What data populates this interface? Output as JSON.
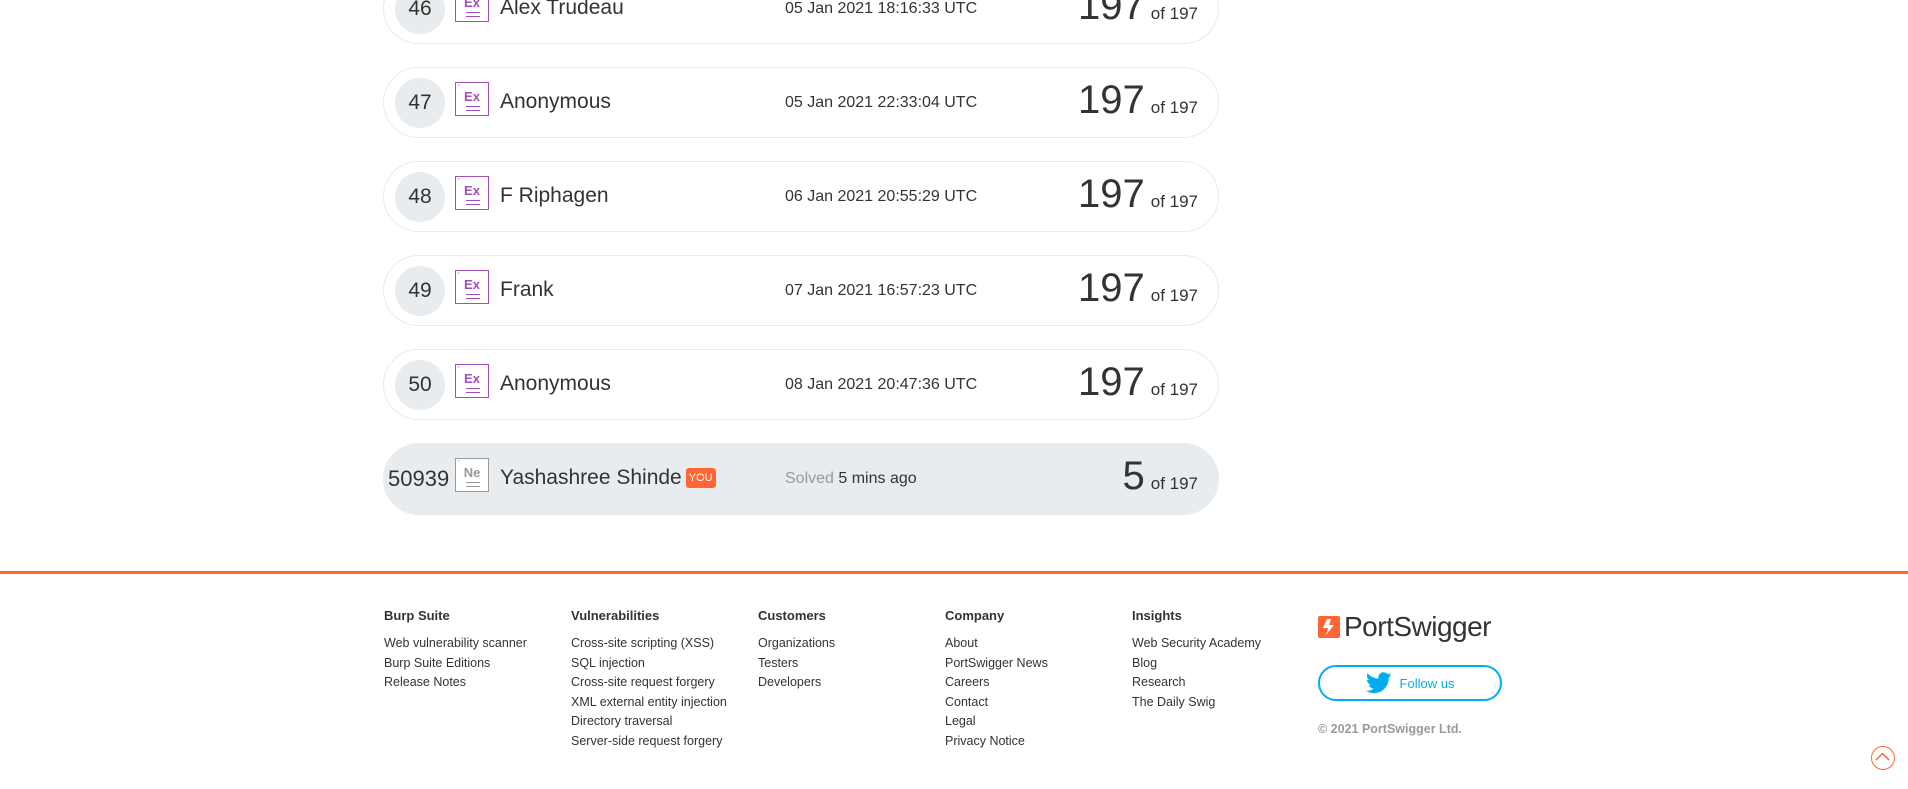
{
  "leaderboard": {
    "total": "of 197",
    "rows": [
      {
        "rank": "46",
        "badge": "Ex",
        "name": "Alex Trudeau",
        "date": "05 Jan 2021 18:16:33 UTC",
        "score": "197"
      },
      {
        "rank": "47",
        "badge": "Ex",
        "name": "Anonymous",
        "date": "05 Jan 2021 22:33:04 UTC",
        "score": "197"
      },
      {
        "rank": "48",
        "badge": "Ex",
        "name": "F Riphagen",
        "date": "06 Jan 2021 20:55:29 UTC",
        "score": "197"
      },
      {
        "rank": "49",
        "badge": "Ex",
        "name": "Frank",
        "date": "07 Jan 2021 16:57:23 UTC",
        "score": "197"
      },
      {
        "rank": "50",
        "badge": "Ex",
        "name": "Anonymous",
        "date": "08 Jan 2021 20:47:36 UTC",
        "score": "197"
      }
    ],
    "me": {
      "rank": "50939",
      "badge": "Ne",
      "name": "Yashashree Shinde",
      "you_label": "YOU",
      "solved_label": "Solved",
      "solved_time": "5 mins ago",
      "score": "5"
    }
  },
  "footer": {
    "columns": [
      {
        "heading": "Burp Suite",
        "links": [
          "Web vulnerability scanner",
          "Burp Suite Editions",
          "Release Notes"
        ]
      },
      {
        "heading": "Vulnerabilities",
        "links": [
          "Cross-site scripting (XSS)",
          "SQL injection",
          "Cross-site request forgery",
          "XML external entity injection",
          "Directory traversal",
          "Server-side request forgery"
        ]
      },
      {
        "heading": "Customers",
        "links": [
          "Organizations",
          "Testers",
          "Developers"
        ]
      },
      {
        "heading": "Company",
        "links": [
          "About",
          "PortSwigger News",
          "Careers",
          "Contact",
          "Legal",
          "Privacy Notice"
        ]
      },
      {
        "heading": "Insights",
        "links": [
          "Web Security Academy",
          "Blog",
          "Research",
          "The Daily Swig"
        ]
      }
    ],
    "brand": "PortSwigger",
    "follow_label": "Follow us",
    "copyright": "© 2021 PortSwigger Ltd."
  },
  "colors": {
    "accent": "#ff6633",
    "expert_badge": "#a24fbb",
    "twitter": "#00aeef"
  }
}
